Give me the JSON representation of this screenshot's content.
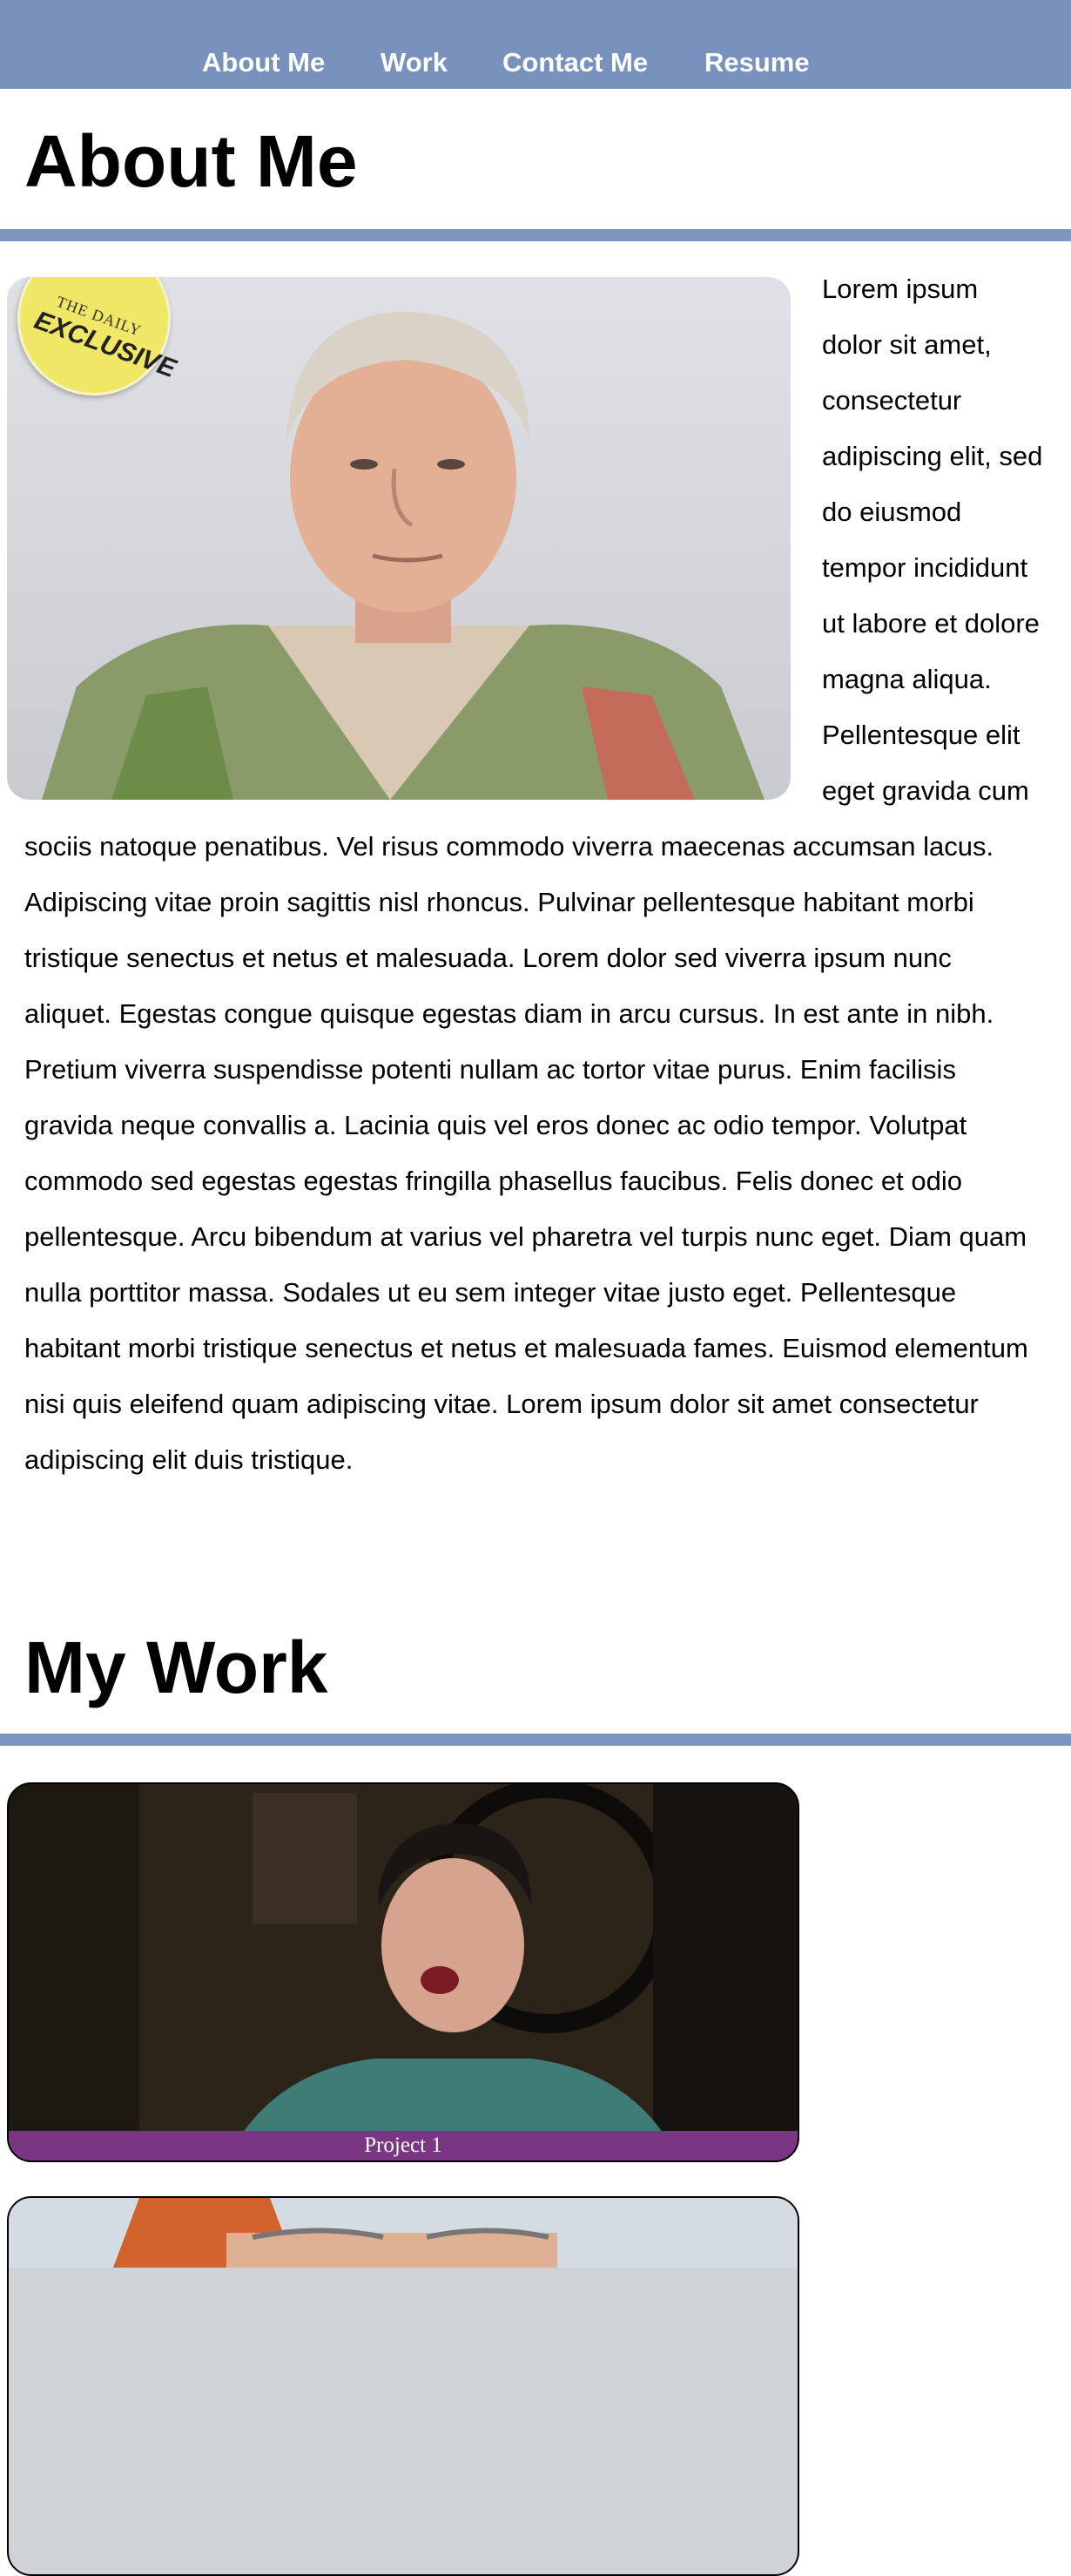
{
  "nav": {
    "items": [
      "About Me",
      "Work",
      "Contact Me",
      "Resume"
    ]
  },
  "about": {
    "title": "About Me",
    "sticker_line1": "THE DAILY",
    "sticker_line2": "EXCLUSIVE",
    "bio": "Lorem ipsum dolor sit amet, consectetur adipiscing elit, sed do eiusmod tempor incididunt ut labore et dolore magna aliqua. Pellentesque elit eget gravida cum sociis natoque penatibus. Vel risus commodo viverra maecenas accumsan lacus. Adipiscing vitae proin sagittis nisl rhoncus. Pulvinar pellentesque habitant morbi tristique senectus et netus et malesuada. Lorem dolor sed viverra ipsum nunc aliquet. Egestas congue quisque egestas diam in arcu cursus. In est ante in nibh. Pretium viverra suspendisse potenti nullam ac tortor vitae purus. Enim facilisis gravida neque convallis a. Lacinia quis vel eros donec ac odio tempor. Volutpat commodo sed egestas egestas fringilla phasellus faucibus. Felis donec et odio pellentesque. Arcu bibendum at varius vel pharetra vel turpis nunc eget. Diam quam nulla porttitor massa. Sodales ut eu sem integer vitae justo eget. Pellentesque habitant morbi tristique senectus et netus et malesuada fames. Euismod elementum nisi quis eleifend quam adipiscing vitae. Lorem ipsum dolor sit amet consectetur adipiscing elit duis tristique."
  },
  "work": {
    "title": "My Work",
    "projects": [
      {
        "caption": "Project 1"
      },
      {
        "caption": ""
      }
    ]
  },
  "colors": {
    "nav_bg": "#7892bd",
    "rule": "#7d96c0",
    "caption_bg": "#7a3682"
  }
}
